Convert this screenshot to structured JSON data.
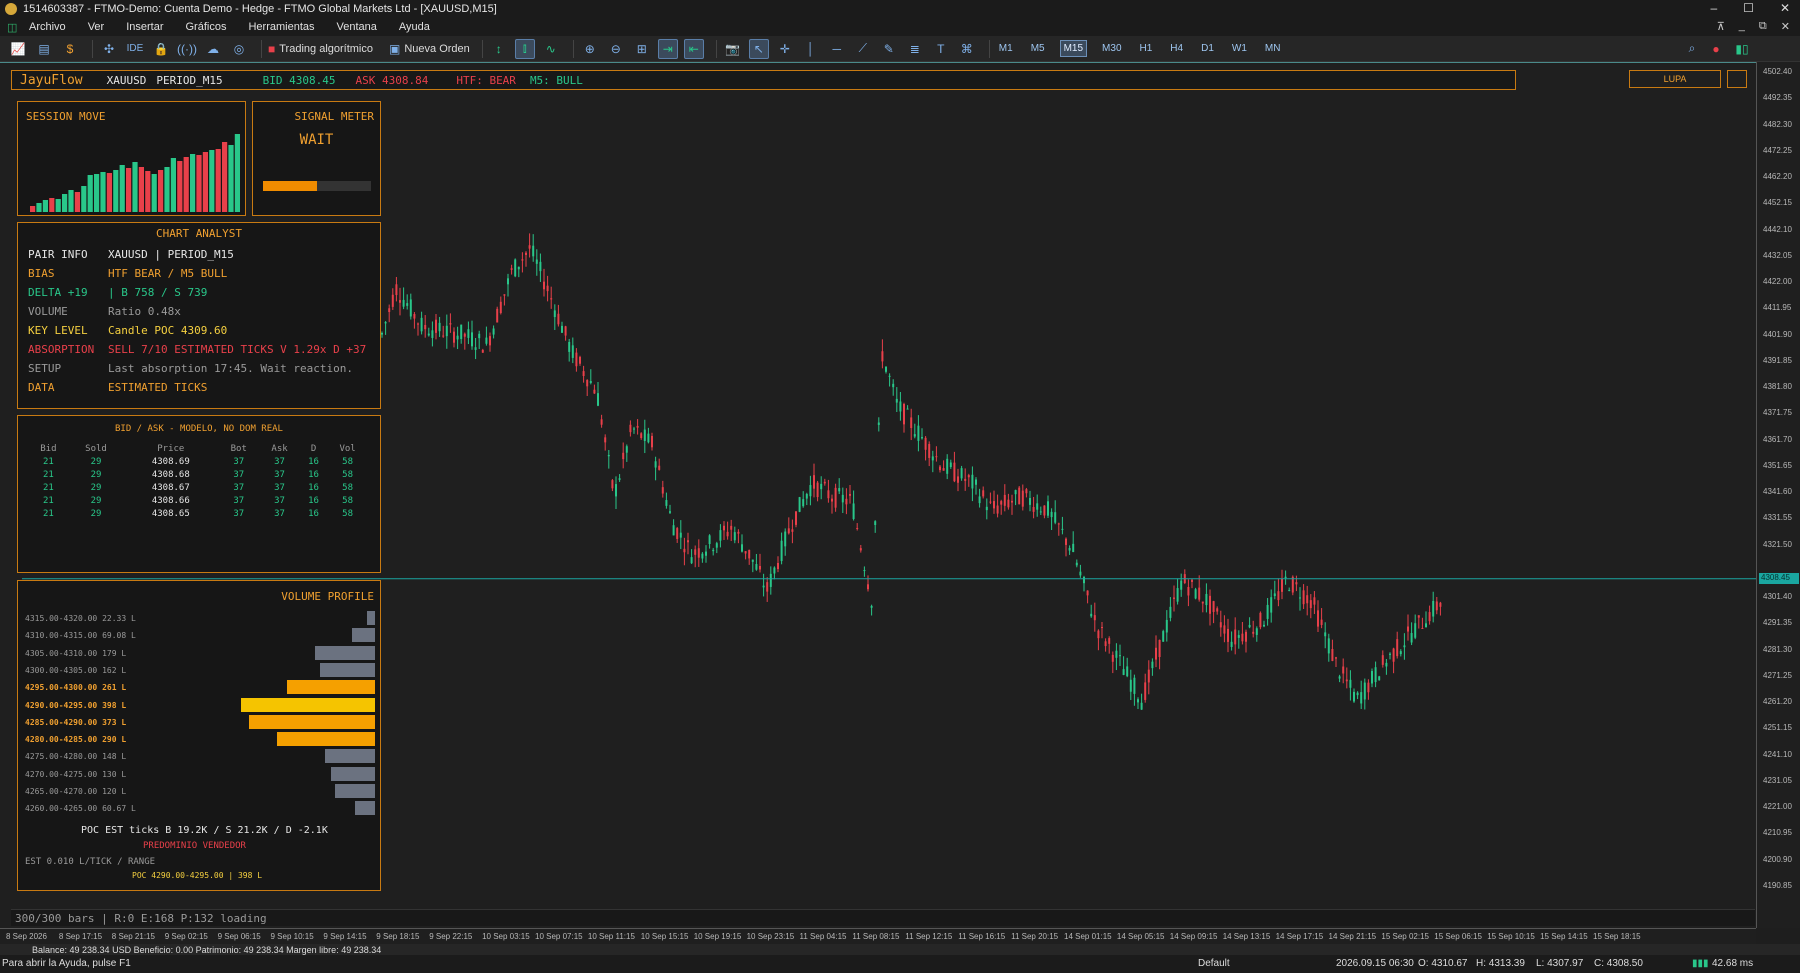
{
  "window": {
    "title": "1514603387 - FTMO-Demo: Cuenta Demo - Hedge - FTMO Global Markets Ltd - [XAUUSD,M15]",
    "buttons": [
      "–",
      "☐",
      "✕"
    ]
  },
  "menu": {
    "items": [
      "Archivo",
      "Ver",
      "Insertar",
      "Gráficos",
      "Herramientas",
      "Ventana",
      "Ayuda"
    ],
    "mdi_buttons": [
      "⊼",
      "_",
      "⧉",
      "✕"
    ]
  },
  "toolbar": {
    "algo_label": "Trading algorítmico",
    "order_label": "Nueva Orden",
    "ide_label": "IDE",
    "timeframes": [
      "M1",
      "M5",
      "M15",
      "M30",
      "H1",
      "H4",
      "D1",
      "W1",
      "MN"
    ],
    "active_timeframe": "M15"
  },
  "hud": {
    "brand": "JayuFlow",
    "symbol": "XAUUSD",
    "period": "PERIOD_M15",
    "bid": "BID 4308.45",
    "ask": "ASK 4308.84",
    "htf": "HTF: BEAR",
    "m5": "M5: BULL",
    "lupa": "LUPA"
  },
  "session": {
    "title": "SESSION MOVE",
    "bars": [
      {
        "v": 6,
        "c": "r"
      },
      {
        "v": 9,
        "c": "g"
      },
      {
        "v": 12,
        "c": "g"
      },
      {
        "v": 14,
        "c": "r"
      },
      {
        "v": 13,
        "c": "g"
      },
      {
        "v": 18,
        "c": "g"
      },
      {
        "v": 22,
        "c": "g"
      },
      {
        "v": 20,
        "c": "r"
      },
      {
        "v": 26,
        "c": "g"
      },
      {
        "v": 37,
        "c": "g"
      },
      {
        "v": 38,
        "c": "g"
      },
      {
        "v": 40,
        "c": "g"
      },
      {
        "v": 39,
        "c": "r"
      },
      {
        "v": 42,
        "c": "g"
      },
      {
        "v": 47,
        "c": "g"
      },
      {
        "v": 44,
        "c": "r"
      },
      {
        "v": 50,
        "c": "g"
      },
      {
        "v": 45,
        "c": "r"
      },
      {
        "v": 41,
        "c": "r"
      },
      {
        "v": 38,
        "c": "g"
      },
      {
        "v": 42,
        "c": "r"
      },
      {
        "v": 45,
        "c": "g"
      },
      {
        "v": 54,
        "c": "g"
      },
      {
        "v": 51,
        "c": "r"
      },
      {
        "v": 55,
        "c": "r"
      },
      {
        "v": 58,
        "c": "g"
      },
      {
        "v": 57,
        "c": "r"
      },
      {
        "v": 60,
        "c": "r"
      },
      {
        "v": 62,
        "c": "g"
      },
      {
        "v": 63,
        "c": "r"
      },
      {
        "v": 70,
        "c": "r"
      },
      {
        "v": 67,
        "c": "g"
      },
      {
        "v": 78,
        "c": "g"
      }
    ]
  },
  "signal": {
    "title": "SIGNAL METER",
    "value": "WAIT",
    "level": 0.5
  },
  "analyst": {
    "title": "CHART ANALYST",
    "rows": [
      {
        "k": "PAIR INFO",
        "v": "XAUUSD | PERIOD_M15",
        "kc": "#e6e6e6",
        "vc": "#e6e6e6"
      },
      {
        "k": "BIAS",
        "v": "HTF BEAR / M5 BULL",
        "kc": "#f0a030",
        "vc": "#f0a030"
      },
      {
        "k": "DELTA +19",
        "v": "| B 758 / S 739",
        "kc": "#29c78a",
        "vc": "#29c78a"
      },
      {
        "k": "VOLUME",
        "v": "Ratio 0.48x",
        "kc": "#9a9a9a",
        "vc": "#9a9a9a"
      },
      {
        "k": "KEY LEVEL",
        "v": "Candle POC 4309.60",
        "kc": "#f5d040",
        "vc": "#f5d040"
      },
      {
        "k": "ABSORPTION",
        "v": "SELL 7/10 ESTIMATED TICKS V 1.29x D +37",
        "kc": "#e8404a",
        "vc": "#e8404a"
      },
      {
        "k": "SETUP",
        "v": "Last absorption 17:45. Wait reaction.",
        "kc": "#9a9a9a",
        "vc": "#9a9a9a"
      },
      {
        "k": "DATA",
        "v": "ESTIMATED TICKS",
        "kc": "#f0a030",
        "vc": "#f0a030"
      }
    ]
  },
  "bidask": {
    "title": "BID / ASK - MODELO, NO DOM REAL",
    "headers": [
      "Bid",
      "Sold",
      "Price",
      "Bot",
      "Ask",
      "D",
      "Vol"
    ],
    "rows": [
      [
        "21",
        "29",
        "4308.69",
        "37",
        "37",
        "16",
        "58"
      ],
      [
        "21",
        "29",
        "4308.68",
        "37",
        "37",
        "16",
        "58"
      ],
      [
        "21",
        "29",
        "4308.67",
        "37",
        "37",
        "16",
        "58"
      ],
      [
        "21",
        "29",
        "4308.66",
        "37",
        "37",
        "16",
        "58"
      ],
      [
        "21",
        "29",
        "4308.65",
        "37",
        "37",
        "16",
        "58"
      ]
    ]
  },
  "volume_profile": {
    "title": "VOLUME PROFILE",
    "rows": [
      {
        "range": "4315.00-4320.00",
        "vol": "22.33 L",
        "v": 22.33,
        "hl": false
      },
      {
        "range": "4310.00-4315.00",
        "vol": "69.08 L",
        "v": 69.08,
        "hl": false
      },
      {
        "range": "4305.00-4310.00",
        "vol": "179 L",
        "v": 179,
        "hl": false
      },
      {
        "range": "4300.00-4305.00",
        "vol": "162 L",
        "v": 162,
        "hl": false
      },
      {
        "range": "4295.00-4300.00",
        "vol": "261 L",
        "v": 261,
        "hl": true
      },
      {
        "range": "4290.00-4295.00",
        "vol": "398 L",
        "v": 398,
        "hl": true,
        "poc": true
      },
      {
        "range": "4285.00-4290.00",
        "vol": "373 L",
        "v": 373,
        "hl": true
      },
      {
        "range": "4280.00-4285.00",
        "vol": "290 L",
        "v": 290,
        "hl": true
      },
      {
        "range": "4275.00-4280.00",
        "vol": "148 L",
        "v": 148,
        "hl": false
      },
      {
        "range": "4270.00-4275.00",
        "vol": "130 L",
        "v": 130,
        "hl": false
      },
      {
        "range": "4265.00-4270.00",
        "vol": "120 L",
        "v": 120,
        "hl": false
      },
      {
        "range": "4260.00-4265.00",
        "vol": "60.67 L",
        "v": 60.67,
        "hl": false
      }
    ],
    "poc_line": "POC EST ticks B 19.2K / S 21.2K / D -2.1K",
    "dominance": "PREDOMINIO VENDEDOR",
    "est": "EST 0.010 L/TICK / RANGE",
    "poc_range": "POC 4290.00-4295.00 | 398 L"
  },
  "status_line": "300/300 bars | R:0 E:168 P:132 loading",
  "price_axis": {
    "ticks": [
      "4502.40",
      "4492.35",
      "4482.30",
      "4472.25",
      "4462.20",
      "4452.15",
      "4442.10",
      "4432.05",
      "4422.00",
      "4411.95",
      "4401.90",
      "4391.85",
      "4381.80",
      "4371.75",
      "4361.70",
      "4351.65",
      "4341.60",
      "4331.55",
      "4321.50",
      "4301.40",
      "4291.35",
      "4281.30",
      "4271.25",
      "4261.20",
      "4251.15",
      "4241.10",
      "4231.05",
      "4221.00",
      "4210.95",
      "4200.90",
      "4190.85"
    ],
    "current": "4308.45"
  },
  "time_axis": {
    "ticks": [
      "8 Sep 2026",
      "8 Sep 17:15",
      "8 Sep 21:15",
      "9 Sep 02:15",
      "9 Sep 06:15",
      "9 Sep 10:15",
      "9 Sep 14:15",
      "9 Sep 18:15",
      "9 Sep 22:15",
      "10 Sep 03:15",
      "10 Sep 07:15",
      "10 Sep 11:15",
      "10 Sep 15:15",
      "10 Sep 19:15",
      "10 Sep 23:15",
      "11 Sep 04:15",
      "11 Sep 08:15",
      "11 Sep 12:15",
      "11 Sep 16:15",
      "11 Sep 20:15",
      "14 Sep 01:15",
      "14 Sep 05:15",
      "14 Sep 09:15",
      "14 Sep 13:15",
      "14 Sep 17:15",
      "14 Sep 21:15",
      "15 Sep 02:15",
      "15 Sep 06:15",
      "15 Sep 10:15",
      "15 Sep 14:15",
      "15 Sep 18:15"
    ]
  },
  "balance": "Balance: 49 238.34 USD  Beneficio: 0.00  Patrimonio: 49 238.34  Margen libre: 49 238.34",
  "statusbar": {
    "help": "Para abrir la Ayuda, pulse F1",
    "profile": "Default",
    "datetime": "2026.09.15 06:30",
    "open": "O: 4310.67",
    "high": "H: 4313.39",
    "low": "L: 4307.97",
    "close": "C: 4308.50",
    "ping": "42.68 ms"
  },
  "colors": {
    "accent": "#c87a12",
    "bull": "#29c78a",
    "bear": "#e8404a",
    "price_line": "#1aa6a0"
  }
}
